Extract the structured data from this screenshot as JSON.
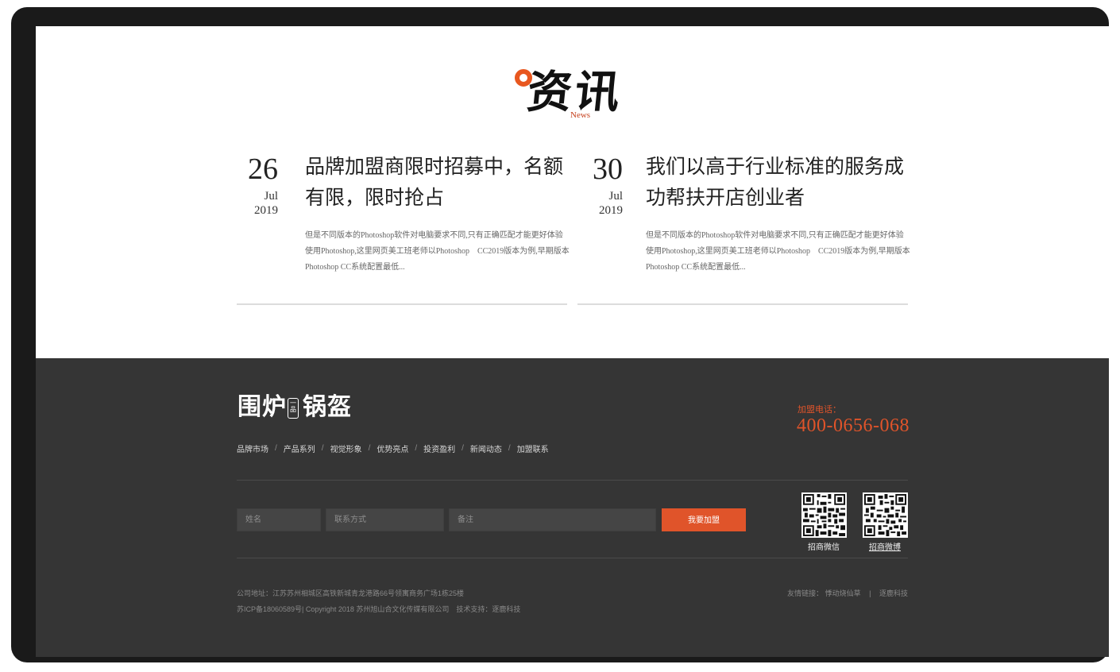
{
  "section": {
    "title": "资讯",
    "subtitle": "News"
  },
  "news": [
    {
      "day": "26",
      "month": "Jul",
      "year": "2019",
      "title": "品牌加盟商限时招募中，名额有限，限时抢占",
      "desc": "但是不同版本的Photoshop软件对电脑要求不同,只有正确匹配才能更好体验使用Photoshop,这里网页美工班老师以Photoshop　CC2019版本为例,早期版本Photoshop CC系统配置最低..."
    },
    {
      "day": "30",
      "month": "Jul",
      "year": "2019",
      "title": "我们以高于行业标准的服务成功帮扶开店创业者",
      "desc": "但是不同版本的Photoshop软件对电脑要求不同,只有正确匹配才能更好体验使用Photoshop,这里网页美工班老师以Photoshop　CC2019版本为例,早期版本Photoshop CC系统配置最低..."
    }
  ],
  "footer": {
    "logo_part1": "围炉",
    "logo_mid": "一品",
    "logo_part2": "锅盔",
    "nav": [
      "品牌市场",
      "产品系列",
      "视觉形象",
      "优势亮点",
      "投资盈利",
      "新闻动态",
      "加盟联系"
    ],
    "nav_separator": "/",
    "phone_label": "加盟电话：",
    "phone": "400-0656-068",
    "form": {
      "name_placeholder": "姓名",
      "contact_placeholder": "联系方式",
      "note_placeholder": "备注",
      "submit_label": "我要加盟"
    },
    "qr": [
      {
        "label": "招商微信",
        "icon": "qr-code-icon"
      },
      {
        "label": "招商微博",
        "icon": "qr-code-icon"
      }
    ],
    "address": "公司地址：江苏苏州相城区高铁新城青龙港路66号领寓商务广场1栋25楼",
    "icp": "苏ICP备18060589号| Copyright 2018 苏州旭山合文化传媒有限公司　技术支持：逐鹿科技",
    "friend_label": "友情链接：",
    "friend_links": [
      "悸动烧仙草",
      "逐鹿科技"
    ],
    "friend_separator": "|"
  },
  "colors": {
    "accent": "#e0542a",
    "footer_bg": "#353535",
    "frame": "#1a1a1a"
  }
}
